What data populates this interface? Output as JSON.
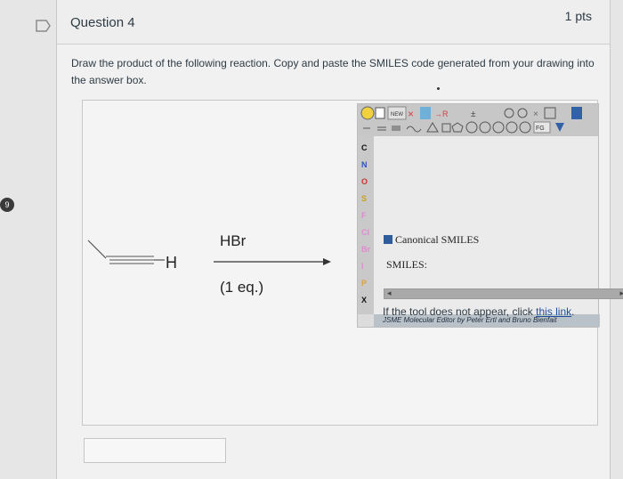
{
  "question": {
    "title": "Question 4",
    "points": "1 pts",
    "prompt": "Draw the product of the following reaction. Copy and paste the SMILES code generated from your drawing into the answer box."
  },
  "reaction": {
    "reagent": "HBr",
    "equivalents": "(1 eq.)",
    "terminal_atom": "H"
  },
  "jsme": {
    "toolbar_new": "NEW",
    "toolbar_fg": "FG",
    "atoms": [
      "C",
      "N",
      "O",
      "S",
      "F",
      "Cl",
      "Br",
      "I",
      "P",
      "X"
    ],
    "status": "JSME Molecular Editor by Peter Ertl and Bruno Bienfait",
    "canonical_label": "Canonical SMILES",
    "smiles_label": "SMILES:"
  },
  "tool_message": {
    "prefix": "If the tool does not appear, click ",
    "link": "this link",
    "suffix": "."
  },
  "side_badge": "9",
  "colors": {
    "link": "#1e4e9b",
    "checkbox": "#2f5d9c",
    "jsme_status": "#b9c1c9"
  }
}
